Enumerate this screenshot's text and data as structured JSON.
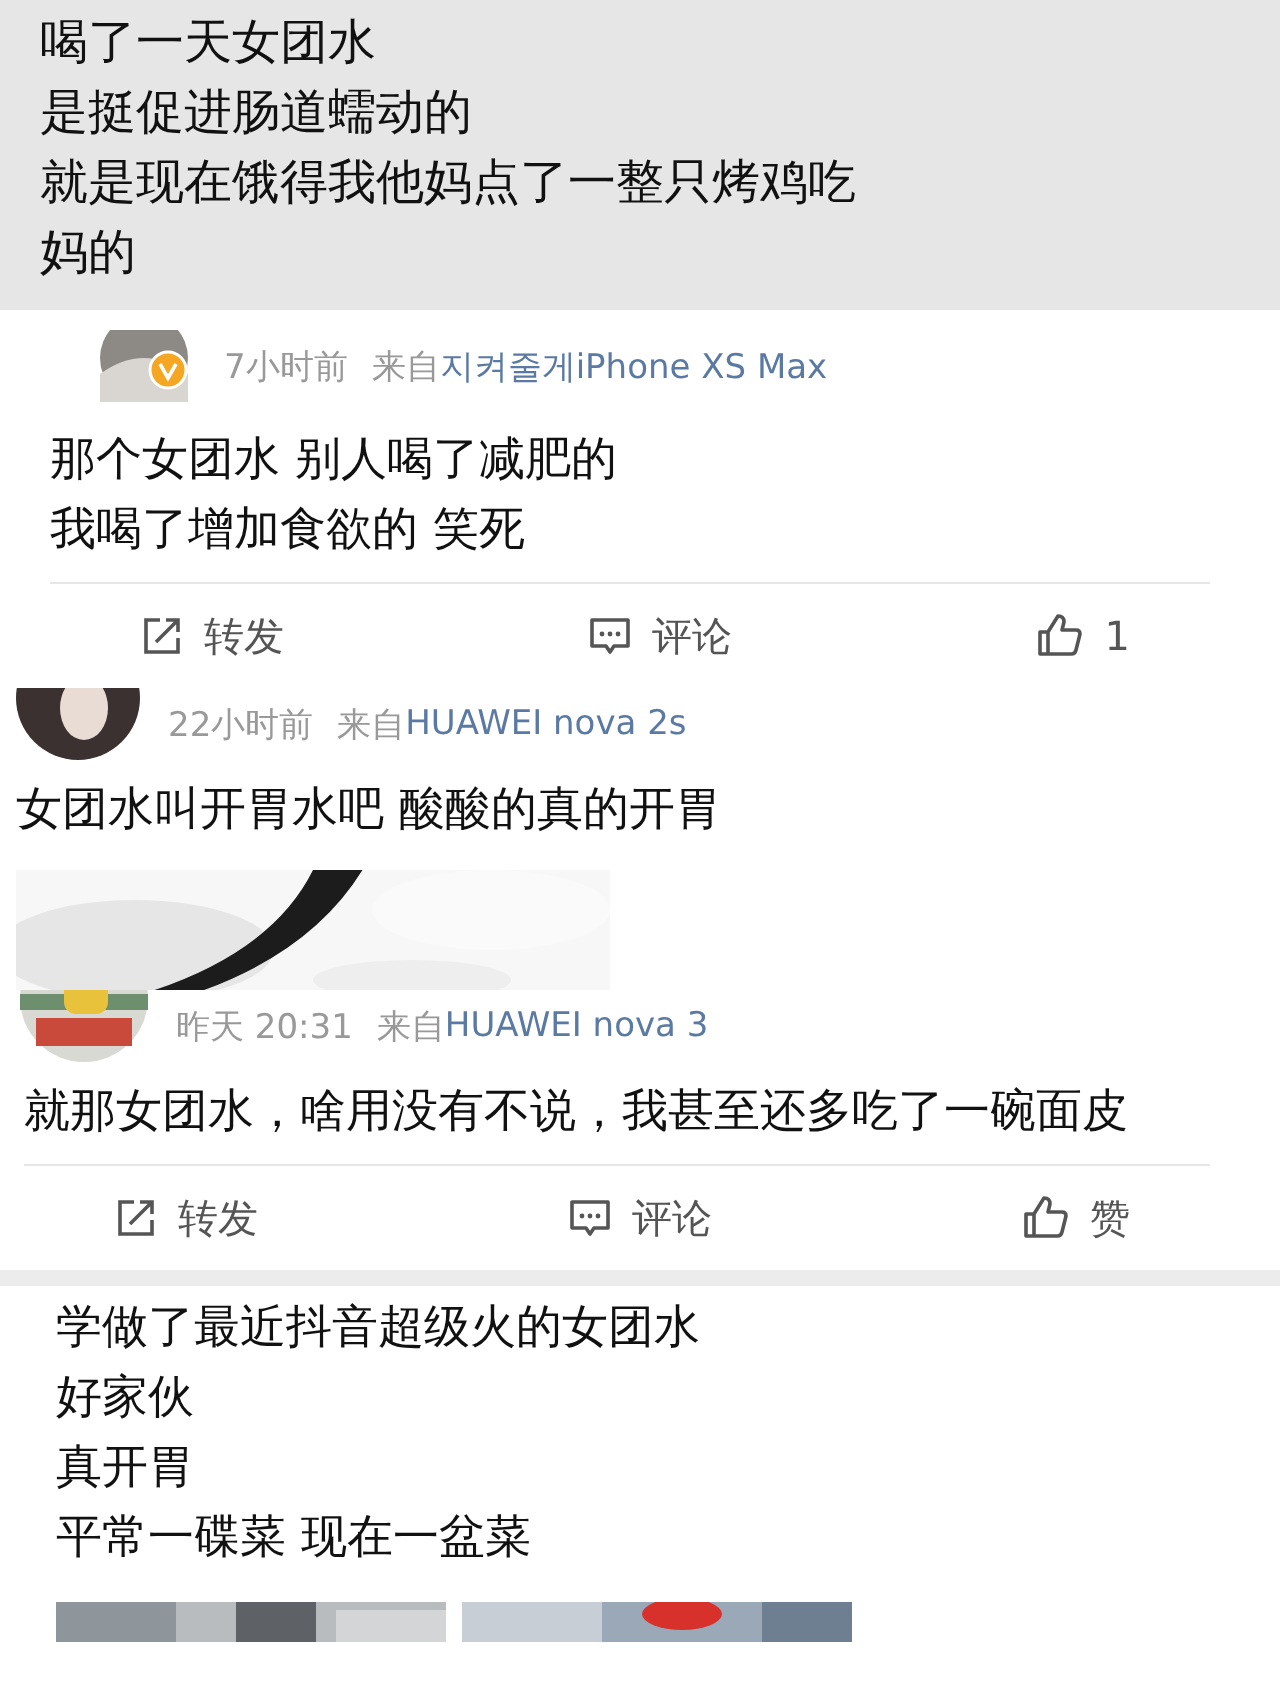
{
  "posts": [
    {
      "kind": "quote",
      "lines": [
        "喝了一天女团水",
        "是挺促进肠道蠕动的",
        "就是现在饿得我他妈点了一整只烤鸡吃",
        "妈的"
      ]
    },
    {
      "kind": "comment",
      "verified": true,
      "time": "7小时前",
      "source_prefix": "来自",
      "source": "지켜줄게iPhone XS Max",
      "lines": [
        "那个女团水 别人喝了减肥的",
        "我喝了增加食欲的 笑死"
      ],
      "actions": [
        {
          "kind": "repost",
          "label": "转发"
        },
        {
          "kind": "comment",
          "label": "评论"
        },
        {
          "kind": "like",
          "label": "1"
        }
      ]
    },
    {
      "kind": "comment",
      "verified": false,
      "time": "22小时前",
      "source_prefix": "来自",
      "source": "HUAWEI nova 2s",
      "lines": [
        "女团水叫开胃水吧 酸酸的真的开胃"
      ],
      "picture": {
        "kind": "picture"
      }
    },
    {
      "kind": "comment",
      "verified": false,
      "time": "昨天 20:31",
      "source_prefix": "来自",
      "source": "HUAWEI nova 3",
      "lines": [
        "就那女团水，啥用没有不说，我甚至还多吃了一碗面皮"
      ],
      "actions": [
        {
          "kind": "repost",
          "label": "转发"
        },
        {
          "kind": "comment",
          "label": "评论"
        },
        {
          "kind": "like",
          "label": "赞"
        }
      ]
    },
    {
      "kind": "quote-photos",
      "lines": [
        "学做了最近抖音超级火的女团水",
        "好家伙",
        "真开胃",
        "平常一碟菜 现在一盆菜"
      ],
      "photos": [
        {
          "kind": "picture"
        },
        {
          "kind": "picture"
        }
      ]
    }
  ]
}
